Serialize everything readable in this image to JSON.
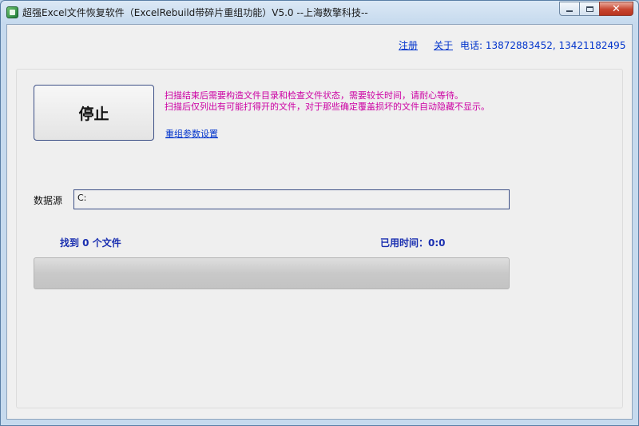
{
  "window": {
    "title": "超强Excel文件恢复软件（ExcelRebuild带碎片重组功能）V5.0  --上海数擎科技--",
    "minimize_icon": "minimize-icon",
    "maximize_icon": "maximize-icon",
    "close_glyph": "✕"
  },
  "header": {
    "register_label": "注册",
    "about_label": "关于",
    "phone_text": "电话: 13872883452, 13421182495"
  },
  "main": {
    "stop_button_label": "停止",
    "info_line_1": "扫描结束后需要构造文件目录和检查文件状态，需要较长时间，请耐心等待。",
    "info_line_2": "扫描后仅列出有可能打得开的文件，对于那些确定覆盖损坏的文件自动隐藏不显示。",
    "settings_link_label": "重组参数设置",
    "source_label": "数据源",
    "source_value": "C:",
    "found_text": "找到 0 个文件",
    "elapsed_text": "已用时间：0:0",
    "progress_fraction": 0
  },
  "colors": {
    "link": "#0033cc",
    "info_text": "#cc00a3",
    "status_text": "#1a2fb0"
  }
}
